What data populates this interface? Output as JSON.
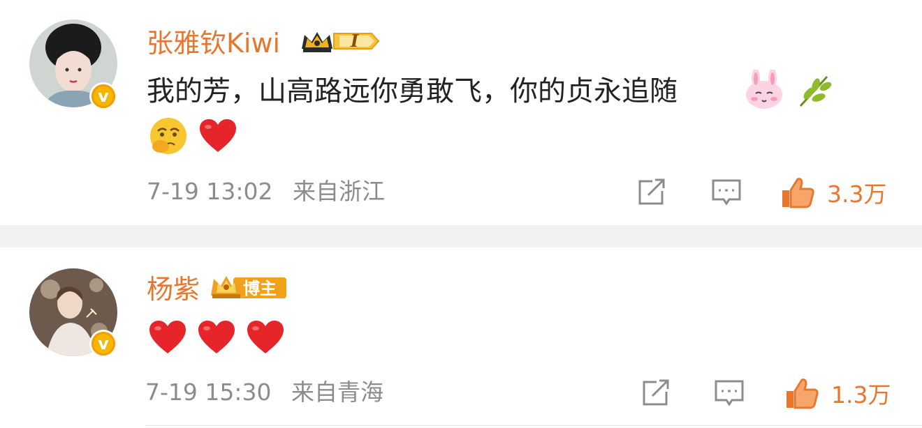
{
  "comments": [
    {
      "user": "张雅钦Kiwi",
      "rank_badge": "I",
      "text": "我的芳，山高路远你勇敢飞，你的贞永追随",
      "inline_emojis": [
        "bunny-emoji",
        "leaf-emoji"
      ],
      "emojis": [
        "thinking-emoji",
        "red-heart-emoji"
      ],
      "date": "7-19 13:02",
      "location": "来自浙江",
      "likes": "3.3万",
      "verified": true
    },
    {
      "user": "杨紫",
      "role_badge": "博主",
      "text": "",
      "emojis": [
        "red-heart-emoji",
        "red-heart-emoji",
        "red-heart-emoji"
      ],
      "date": "7-19 15:30",
      "location": "来自青海",
      "likes": "1.3万",
      "verified": true
    }
  ],
  "colors": {
    "name": "#e8772e",
    "meta": "#8c8c8c",
    "divider": "#f2f2f2",
    "heart": "#e5252a",
    "verified_badge": "#f7b500"
  }
}
